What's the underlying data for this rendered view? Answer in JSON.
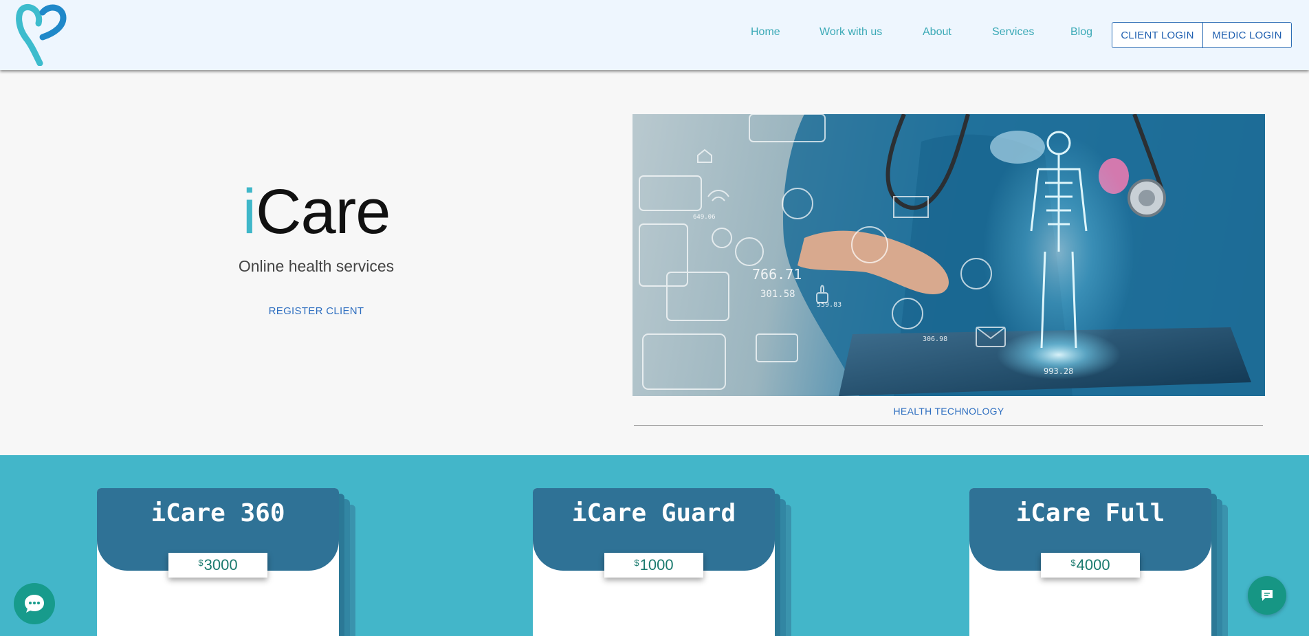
{
  "header": {
    "nav": [
      {
        "label": "Home"
      },
      {
        "label": "Work with us"
      },
      {
        "label": "About"
      },
      {
        "label": "Services"
      },
      {
        "label": "Blog"
      }
    ],
    "client_login": "CLIENT LOGIN",
    "medic_login": "MEDIC LOGIN"
  },
  "hero": {
    "brand_i": "i",
    "brand_rest": "Care",
    "tagline": "Online health services",
    "register": "REGISTER CLIENT",
    "image_readouts": [
      "649.06",
      "766.71",
      "301.58",
      "559.83",
      "306.98",
      "993.28"
    ],
    "caption": "HEALTH TECHNOLOGY"
  },
  "plans": [
    {
      "name": "iCare 360",
      "currency": "$",
      "price": "3000"
    },
    {
      "name": "iCare Guard",
      "currency": "$",
      "price": "1000"
    },
    {
      "name": "iCare Full",
      "currency": "$",
      "price": "4000"
    }
  ],
  "colors": {
    "accent": "#43b6c9",
    "header_bg": "#eef6fe",
    "card_cap": "#2f7296",
    "chat": "#179b8c",
    "link": "#2f6fc0"
  },
  "icons": {
    "logo": "heart-logo-icon",
    "chat_left": "chat-bubble-icon",
    "chat_right": "message-icon"
  }
}
